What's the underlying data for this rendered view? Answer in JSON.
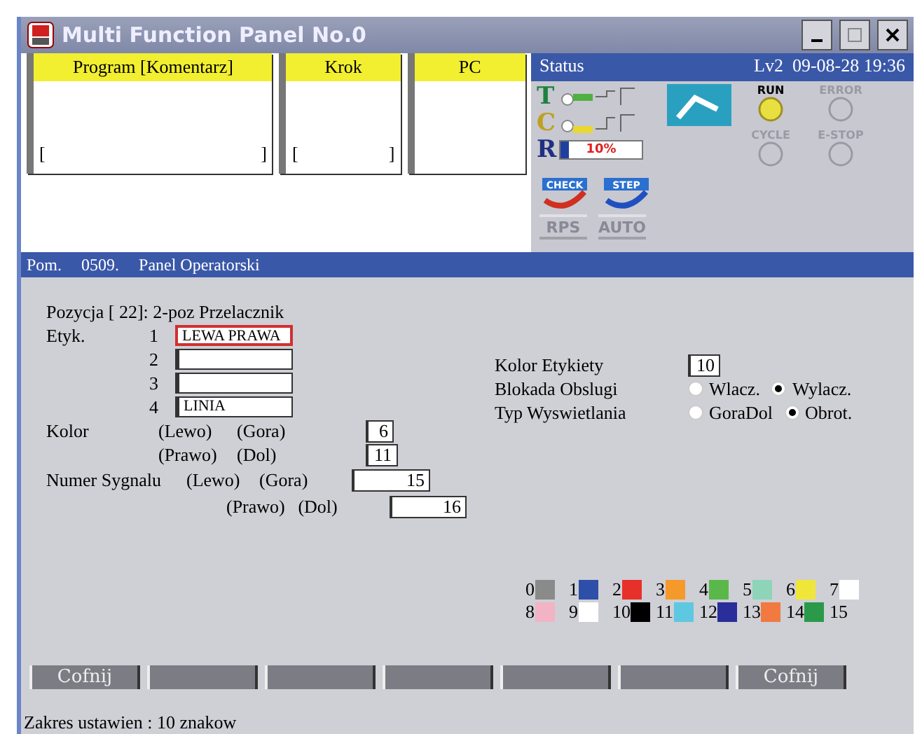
{
  "window": {
    "title": "Multi Function Panel No.0"
  },
  "panels": [
    {
      "header": "Program [Komentarz]",
      "open": "[",
      "close": "]"
    },
    {
      "header": "Krok",
      "open": "[",
      "close": "]"
    },
    {
      "header": "PC"
    }
  ],
  "status": {
    "title": "Status",
    "level_label": "Lv2",
    "datetime": "09-08-28 19:36",
    "rows": [
      {
        "letter": "T",
        "on": true
      },
      {
        "letter": "C",
        "on": false
      },
      {
        "letter": "R",
        "level": 0.1,
        "reading": "10%"
      }
    ],
    "indicators": [
      {
        "label": "RUN",
        "active": true
      },
      {
        "label": "ERROR",
        "active": false
      },
      {
        "label": "CYCLE",
        "active": false
      },
      {
        "label": "E-STOP",
        "active": false
      }
    ],
    "modes": [
      {
        "label": "CHECK"
      },
      {
        "label": "STEP"
      }
    ],
    "buttons": [
      "RPS",
      "AUTO"
    ]
  },
  "section": {
    "code": "Pom.",
    "number": "0509.",
    "title": "Panel Operatorski"
  },
  "form": {
    "position": "Pozycja [ 22]: 2-poz Przelacznik",
    "labels": [
      {
        "name": "Etyk.",
        "index": "1",
        "value": "LEWA PRAWA",
        "focused": true
      },
      {
        "index": "2",
        "focused": false
      },
      {
        "index": "3",
        "focused": false
      },
      {
        "index": "4",
        "value": "LINIA",
        "focused": false
      }
    ],
    "color_rows": [
      {
        "name": "Kolor",
        "a": "(Lewo)",
        "b": "(Gora)",
        "value": "6"
      },
      {
        "a": "(Prawo)",
        "b": "(Dol)",
        "value": "11"
      }
    ],
    "signal_rows": [
      {
        "name": "Numer Sygnalu",
        "a": "(Lewo)",
        "b": "(Gora)",
        "value": "15"
      },
      {
        "a": "(Prawo)",
        "b": "(Dol)",
        "value": "16"
      }
    ],
    "label_color": {
      "name": "Kolor Etykiety",
      "value": "10"
    },
    "radio_groups": [
      {
        "name": "Blokada Obslugi",
        "options": [
          {
            "label": "Wlacz.",
            "selected": false
          },
          {
            "label": "Wylacz.",
            "selected": true
          }
        ]
      },
      {
        "name": "Typ Wyswietlania",
        "options": [
          {
            "label": "GoraDol",
            "selected": false
          },
          {
            "label": "Obrot.",
            "selected": true
          }
        ]
      }
    ]
  },
  "palette": [
    {
      "label": "0",
      "color": "#8a8a8a"
    },
    {
      "label": "1",
      "color": "#2e4fa8"
    },
    {
      "label": "2",
      "color": "#e8302a"
    },
    {
      "label": "3",
      "color": "#f59a2a"
    },
    {
      "label": "4",
      "color": "#5ab84a"
    },
    {
      "label": "5",
      "color": "#8ed4b8"
    },
    {
      "label": "6",
      "color": "#f0e63a"
    },
    {
      "label": "7",
      "color": "#ffffff"
    },
    {
      "label": "8",
      "color": "#f2b4c4"
    },
    {
      "label": "9",
      "color": "#ffffff"
    },
    {
      "label": "10",
      "color": "#000000"
    },
    {
      "label": "11",
      "color": "#5ec8e0"
    },
    {
      "label": "12",
      "color": "#2a2e9a"
    },
    {
      "label": "13",
      "color": "#f07a40"
    },
    {
      "label": "14",
      "color": "#2a9a4a"
    },
    {
      "label": "15"
    }
  ],
  "function_keys": [
    {
      "kind": "labeled",
      "label": "Cofnij"
    },
    {
      "kind": "blank"
    },
    {
      "kind": "blank"
    },
    {
      "kind": "blank"
    },
    {
      "kind": "blank"
    },
    {
      "kind": "blank"
    },
    {
      "kind": "labeled",
      "label": "Cofnij"
    }
  ],
  "message": "Zakres ustawien : 10 znakow"
}
